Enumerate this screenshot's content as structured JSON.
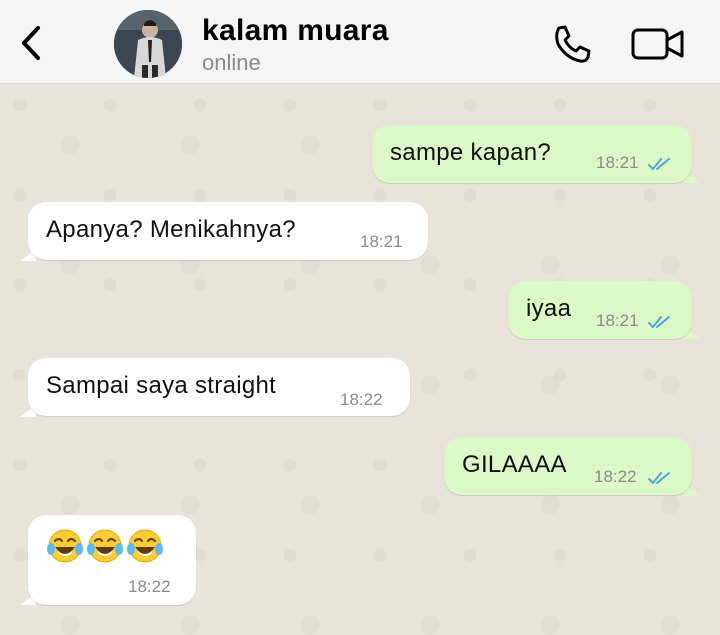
{
  "header": {
    "contact_name": "kalam muara",
    "status": "online",
    "back_icon": "chevron-left-icon",
    "call_icon": "phone-icon",
    "video_icon": "video-camera-icon"
  },
  "colors": {
    "outgoing_bubble": "#dcf8c6",
    "incoming_bubble": "#ffffff",
    "read_ticks": "#4fa3e0",
    "chat_background": "#e9e4da"
  },
  "messages": [
    {
      "direction": "outgoing",
      "text": "sampe kapan?",
      "time": "18:21",
      "status": "read"
    },
    {
      "direction": "incoming",
      "text": "Apanya? Menikahnya?",
      "time": "18:21"
    },
    {
      "direction": "outgoing",
      "text": "iyaa",
      "time": "18:21",
      "status": "read"
    },
    {
      "direction": "incoming",
      "text": "Sampai saya straight",
      "time": "18:22"
    },
    {
      "direction": "outgoing",
      "text": "GILAAAA",
      "time": "18:22",
      "status": "read"
    },
    {
      "direction": "incoming",
      "text": "",
      "emoji": [
        "face-with-tears-of-joy",
        "face-with-tears-of-joy",
        "face-with-tears-of-joy"
      ],
      "time": "18:22"
    }
  ]
}
